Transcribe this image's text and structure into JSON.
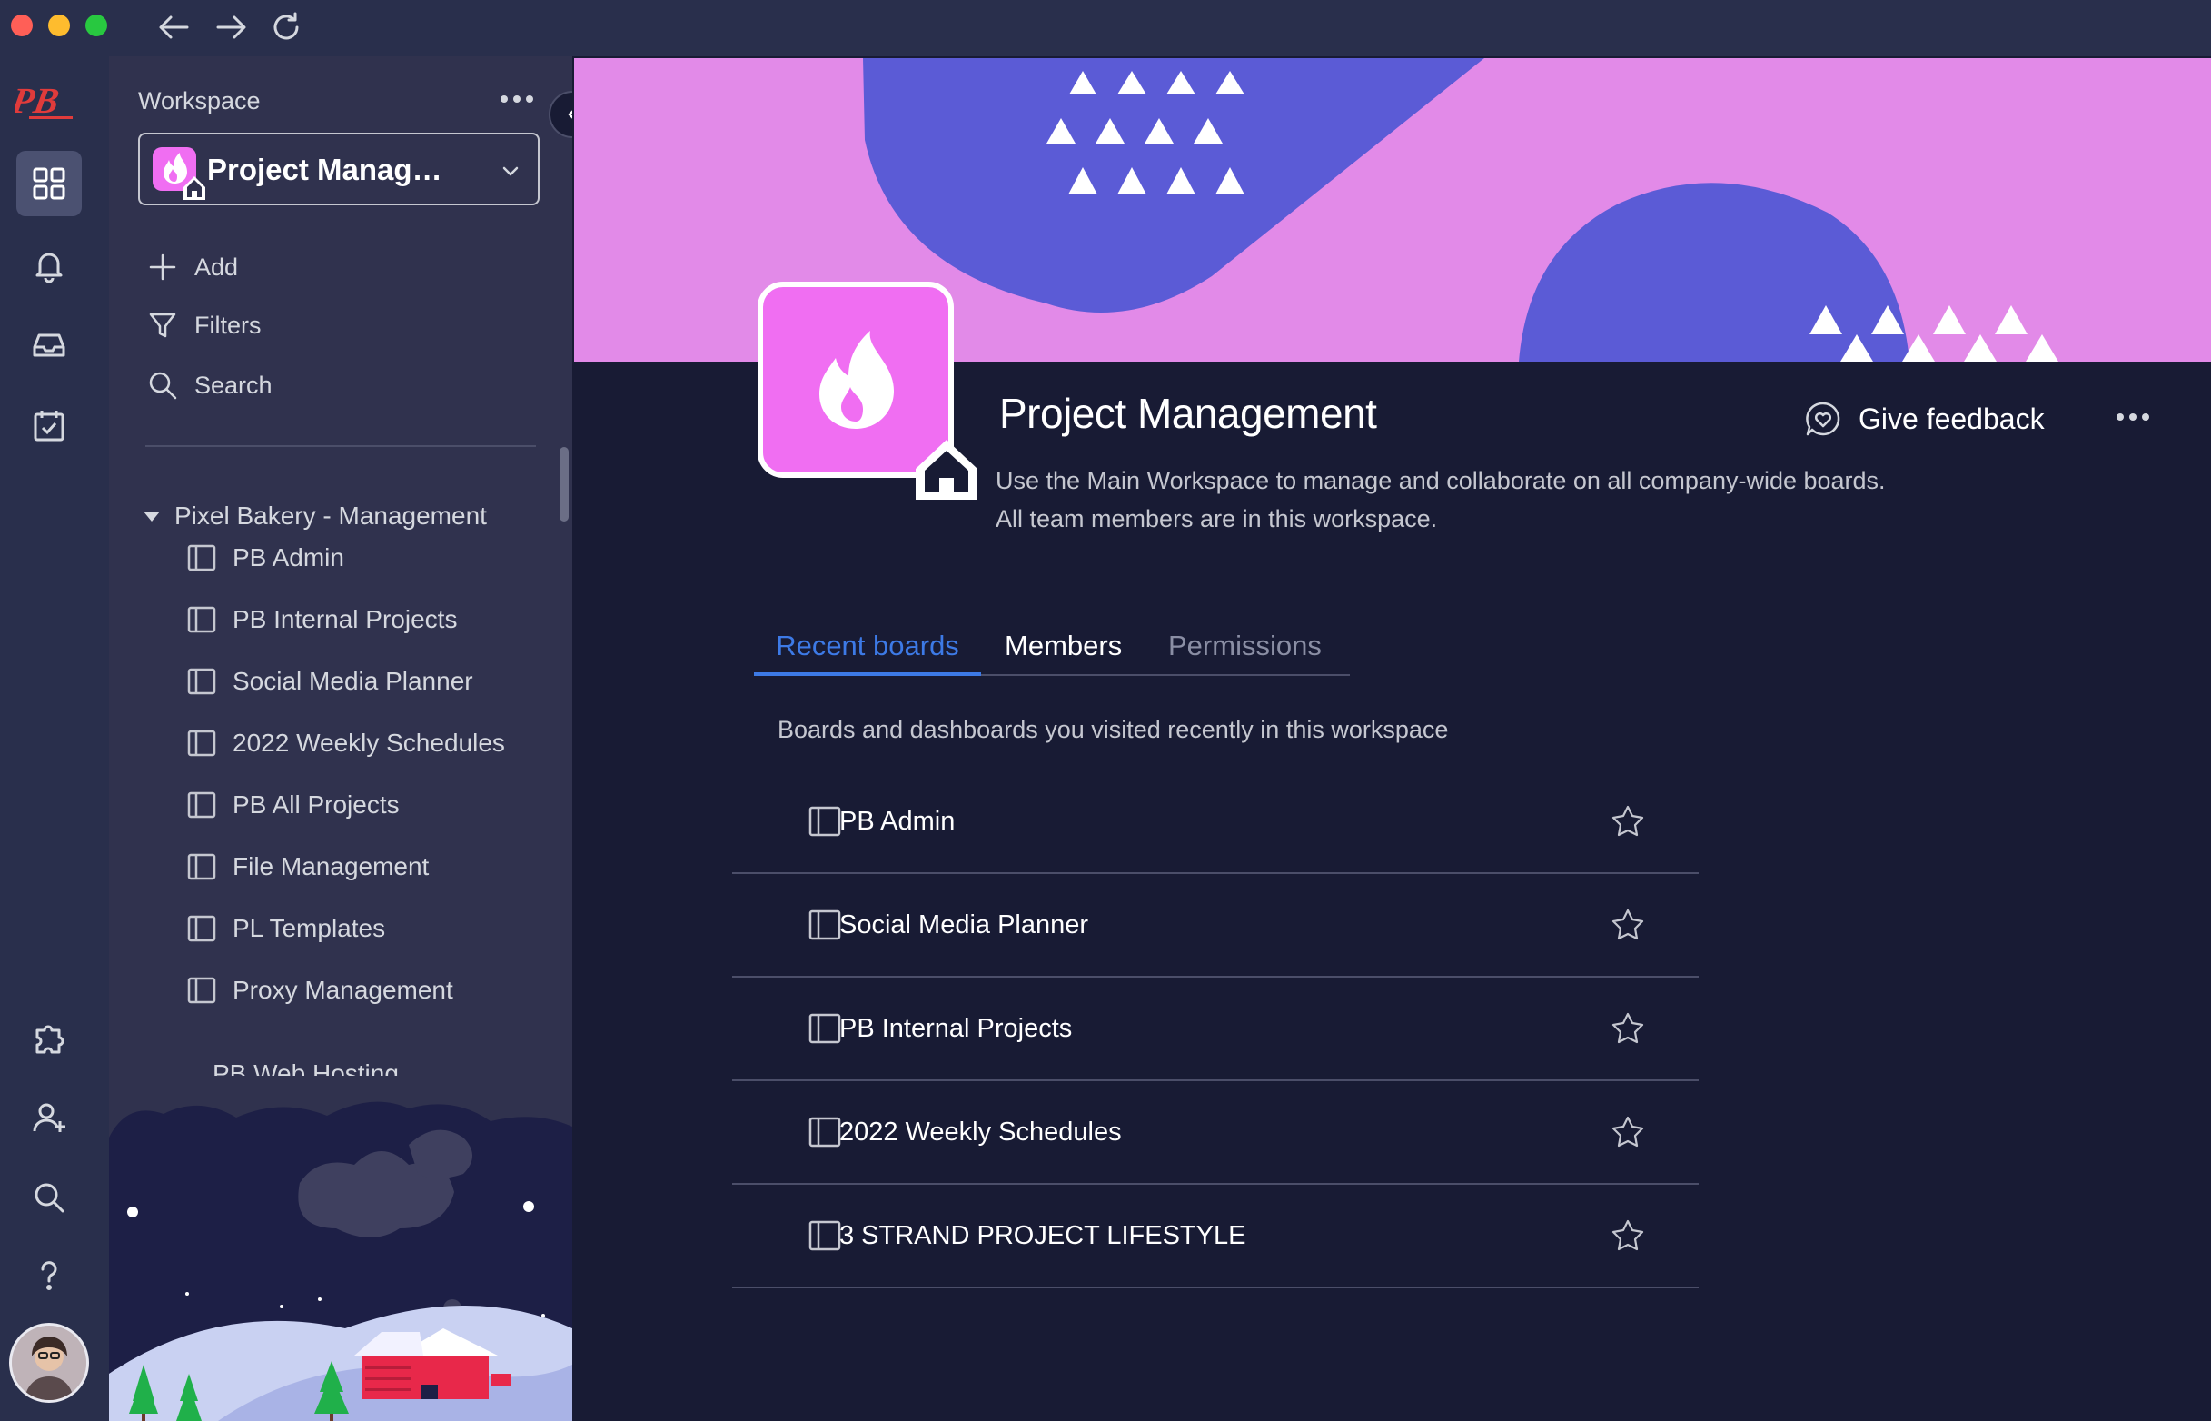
{
  "titlebar": {
    "nav": [
      "back-arrow-icon",
      "forward-arrow-icon",
      "reload-icon"
    ]
  },
  "rail": {
    "logo_text": "PB",
    "items": [
      "workspaces-icon",
      "bell-icon",
      "inbox-icon",
      "calendar-check-icon"
    ],
    "bottom_items": [
      "puzzle-icon",
      "add-user-icon",
      "search-icon",
      "help-icon"
    ]
  },
  "sidebar": {
    "title": "Workspace",
    "workspace_name": "Project Manage...",
    "actions": {
      "add": "Add",
      "filters": "Filters",
      "search": "Search"
    },
    "folder": "Pixel Bakery - Management",
    "boards": [
      "PB Admin",
      "PB Internal Projects",
      "Social Media Planner",
      "2022 Weekly Schedules",
      "PB All Projects",
      "File Management",
      "PL Templates",
      "Proxy Management",
      "PB Web Hosting"
    ]
  },
  "main": {
    "title": "Project Management",
    "description_line1": "Use the Main Workspace to manage and collaborate on all company-wide boards.",
    "description_line2": "All team members are in this workspace.",
    "feedback_label": "Give feedback",
    "tabs": [
      "Recent boards",
      "Members",
      "Permissions"
    ],
    "active_tab": "Recent boards",
    "recent_caption": "Boards and dashboards you visited recently in this workspace",
    "recent_boards": [
      "PB Admin",
      "Social Media Planner",
      "PB Internal Projects",
      "2022 Weekly Schedules",
      "3 STRAND PROJECT LIFESTYLE"
    ]
  },
  "colors": {
    "accent": "#3d7ae6",
    "workspace_icon": "#f06ef2",
    "banner_pink": "#e28ae8",
    "banner_blue": "#5b5bd6",
    "background": "#181b34",
    "sidebar": "#30324e",
    "rail": "#292f4c"
  }
}
